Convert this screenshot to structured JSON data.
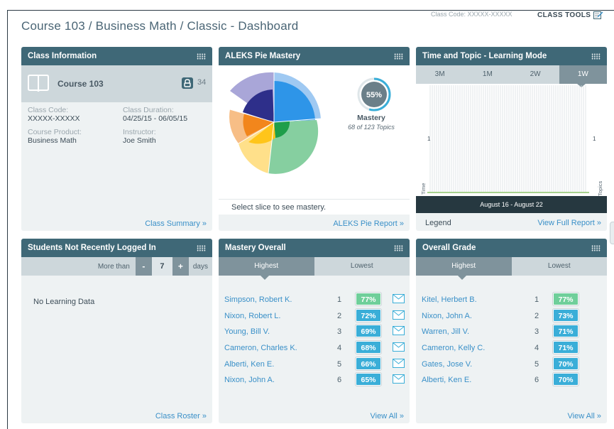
{
  "header": {
    "title": "Course 103 / Business Math / Classic - Dashboard",
    "class_code": "Class Code: XXXXX-XXXXX",
    "class_tools": "CLASS TOOLS"
  },
  "class_info": {
    "title": "Class Information",
    "course_name": "Course 103",
    "student_count": "34",
    "class_code_label": "Class Code:",
    "class_code_value": "XXXXX-XXXXX",
    "duration_label": "Class Duration:",
    "duration_value": "04/25/15 - 06/05/15",
    "product_label": "Course Product:",
    "product_value": "Business Math",
    "instructor_label": "Instructor:",
    "instructor_value": "Joe Smith",
    "link": "Class Summary »"
  },
  "pie": {
    "title": "ALEKS Pie Mastery",
    "mastery_percent": "55%",
    "mastery_fraction": 0.55,
    "mastery_label": "Mastery",
    "mastery_sub": "68 of 123 Topics",
    "select_note": "Select slice to see mastery.",
    "link": "ALEKS Pie Report »",
    "colors": {
      "blue": "#2e95e8",
      "green": "#86cfa0",
      "yellow": "#ffd54a",
      "orange": "#f5a04a",
      "navy": "#2e2f8a",
      "lavender": "#a9a6d8"
    }
  },
  "time_topic": {
    "title": "Time and Topic - Learning Mode",
    "tabs": [
      "3M",
      "1M",
      "2W",
      "1W"
    ],
    "active_tab": "1W",
    "y_left_tick": "1",
    "y_right_tick": "1",
    "y_left_label": "Time",
    "y_right_label": "Topics",
    "date_range": "August 16 - August 22",
    "legend": "Legend",
    "link": "View Full Report »"
  },
  "students": {
    "title": "Students Not Recently Logged In",
    "more_than": "More than",
    "minus": "-",
    "days_value": "7",
    "plus": "+",
    "days": "days",
    "empty": "No Learning Data",
    "link": "Class Roster »"
  },
  "mastery_overall": {
    "title": "Mastery Overall",
    "tab_high": "Highest",
    "tab_low": "Lowest",
    "rows": [
      {
        "name": "Simpson, Robert K.",
        "rank": "1",
        "pct": "77%",
        "color": "#6fcf9a"
      },
      {
        "name": "Nixon, Robert L.",
        "rank": "2",
        "pct": "72%",
        "color": "#3aaed8"
      },
      {
        "name": "Young, Bill V.",
        "rank": "3",
        "pct": "69%",
        "color": "#3aaed8"
      },
      {
        "name": "Cameron, Charles K.",
        "rank": "4",
        "pct": "68%",
        "color": "#3aaed8"
      },
      {
        "name": "Alberti, Ken E.",
        "rank": "5",
        "pct": "66%",
        "color": "#3aaed8"
      },
      {
        "name": "Nixon, John A.",
        "rank": "6",
        "pct": "65%",
        "color": "#3aaed8"
      }
    ],
    "link": "View All »"
  },
  "overall_grade": {
    "title": "Overall Grade",
    "tab_high": "Highest",
    "tab_low": "Lowest",
    "rows": [
      {
        "name": "Kitel, Herbert B.",
        "rank": "1",
        "pct": "77%",
        "color": "#6fcf9a"
      },
      {
        "name": "Nixon, John A.",
        "rank": "2",
        "pct": "73%",
        "color": "#3aaed8"
      },
      {
        "name": "Warren, Jill V.",
        "rank": "3",
        "pct": "71%",
        "color": "#3aaed8"
      },
      {
        "name": "Cameron, Kelly C.",
        "rank": "4",
        "pct": "71%",
        "color": "#3aaed8"
      },
      {
        "name": "Gates, Jose V.",
        "rank": "5",
        "pct": "70%",
        "color": "#3aaed8"
      },
      {
        "name": "Alberti, Ken E.",
        "rank": "6",
        "pct": "70%",
        "color": "#3aaed8"
      }
    ],
    "link": "View All »"
  }
}
